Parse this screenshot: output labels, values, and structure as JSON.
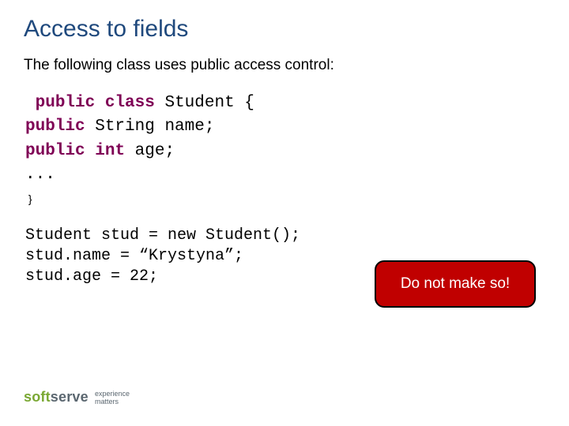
{
  "title": "Access to fields",
  "intro": "The following class uses public access control:",
  "code": {
    "kw_public": "public",
    "kw_class": "class",
    "kw_int": "int",
    "cls_decl_tail": " Student {",
    "str_type": " String name;",
    "int_tail": " age;",
    "ellipsis": "...",
    "close": " }"
  },
  "usage": "Student stud = new Student();\nstud.name = “Krystyna”;\nstud.age = 22;",
  "callout": "Do not make so!",
  "logo": {
    "part1": "soft",
    "part2": "serve"
  },
  "tagline_l1": "experience",
  "tagline_l2": "matters"
}
